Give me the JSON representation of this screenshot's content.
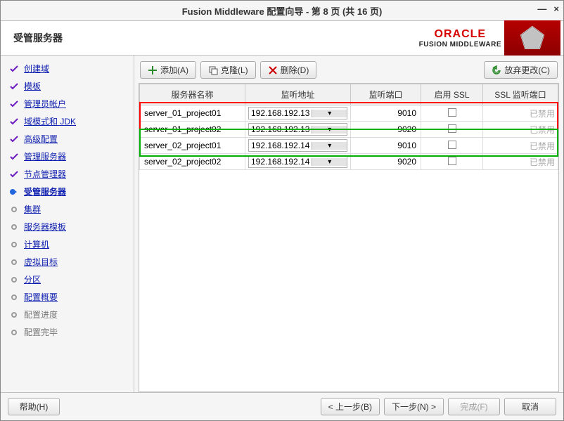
{
  "window": {
    "title": "Fusion Middleware 配置向导 - 第 8 页 (共 16 页)"
  },
  "banner": {
    "heading": "受管服务器",
    "oracle": "ORACLE",
    "product": "FUSION MIDDLEWARE"
  },
  "sidebar": {
    "items": [
      {
        "label": "创建域",
        "state": "done"
      },
      {
        "label": "模板",
        "state": "done"
      },
      {
        "label": "管理员帐户",
        "state": "done"
      },
      {
        "label": "域模式和 JDK",
        "state": "done"
      },
      {
        "label": "高级配置",
        "state": "done"
      },
      {
        "label": "管理服务器",
        "state": "done"
      },
      {
        "label": "节点管理器",
        "state": "done"
      },
      {
        "label": "受管服务器",
        "state": "current"
      },
      {
        "label": "集群",
        "state": "pending"
      },
      {
        "label": "服务器模板",
        "state": "pending"
      },
      {
        "label": "计算机",
        "state": "pending"
      },
      {
        "label": "虚拟目标",
        "state": "pending"
      },
      {
        "label": "分区",
        "state": "pending"
      },
      {
        "label": "配置概要",
        "state": "pending"
      },
      {
        "label": "配置进度",
        "state": "disabled"
      },
      {
        "label": "配置完毕",
        "state": "disabled"
      }
    ]
  },
  "toolbar": {
    "add_label": "添加(A)",
    "clone_label": "克隆(L)",
    "delete_label": "删除(D)",
    "discard_label": "放弃更改(C)"
  },
  "table": {
    "columns": {
      "name": "服务器名称",
      "addr": "监听地址",
      "port": "监听端口",
      "ssl": "启用 SSL",
      "ssl_port": "SSL 监听端口"
    },
    "rows": [
      {
        "name": "server_01_project01",
        "addr": "192.168.192.13",
        "port": "9010",
        "ssl": false,
        "ssl_port_text": "已禁用"
      },
      {
        "name": "server_01_project02",
        "addr": "192.168.192.13",
        "port": "9020",
        "ssl": false,
        "ssl_port_text": "已禁用"
      },
      {
        "name": "server_02_project01",
        "addr": "192.168.192.14",
        "port": "9010",
        "ssl": false,
        "ssl_port_text": "已禁用"
      },
      {
        "name": "server_02_project02",
        "addr": "192.168.192.14",
        "port": "9020",
        "ssl": false,
        "ssl_port_text": "已禁用"
      }
    ]
  },
  "footer": {
    "help": "帮助(H)",
    "back": "< 上一步(B)",
    "next": "下一步(N) >",
    "finish": "完成(F)",
    "cancel": "取消"
  }
}
